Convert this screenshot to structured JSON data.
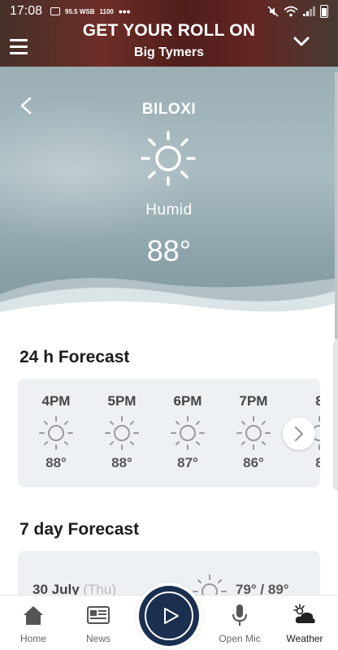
{
  "status_bar": {
    "time": "17:08",
    "left_icons": [
      "image-icon",
      "95.5 WSB",
      "1100"
    ],
    "overflow": "•••",
    "right_icons": [
      "mute-icon",
      "wifi-icon",
      "signal-icon",
      "battery-icon"
    ]
  },
  "now_playing": {
    "title": "GET YOUR ROLL ON",
    "artist": "Big Tymers"
  },
  "weather": {
    "city": "BILOXI",
    "condition": "Humid",
    "temperature": "88°"
  },
  "hourly_forecast": {
    "title": "24 h Forecast",
    "hours": [
      {
        "time": "4PM",
        "temp": "88°",
        "icon": "sun-icon"
      },
      {
        "time": "5PM",
        "temp": "88°",
        "icon": "sun-icon"
      },
      {
        "time": "6PM",
        "temp": "87°",
        "icon": "sun-icon"
      },
      {
        "time": "7PM",
        "temp": "86°",
        "icon": "sun-icon"
      },
      {
        "time": "8",
        "temp": "8",
        "icon": "sun-icon"
      }
    ]
  },
  "daily_forecast": {
    "title": "7 day Forecast",
    "days": [
      {
        "date": "30 July",
        "weekday": "(Thu)",
        "temps": "79° / 89°",
        "icon": "sun-icon"
      }
    ]
  },
  "bottom_nav": {
    "items": [
      {
        "label": "Home",
        "icon": "home-icon"
      },
      {
        "label": "News",
        "icon": "news-icon"
      },
      {
        "label": "Open Mic",
        "icon": "microphone-icon"
      },
      {
        "label": "Weather",
        "icon": "weather-icon"
      }
    ],
    "play_icon": "play-icon"
  },
  "colors": {
    "nav_dark": "#1b2f50",
    "card_bg": "#eef1f4",
    "hero_sky": "#a9bcc2"
  }
}
